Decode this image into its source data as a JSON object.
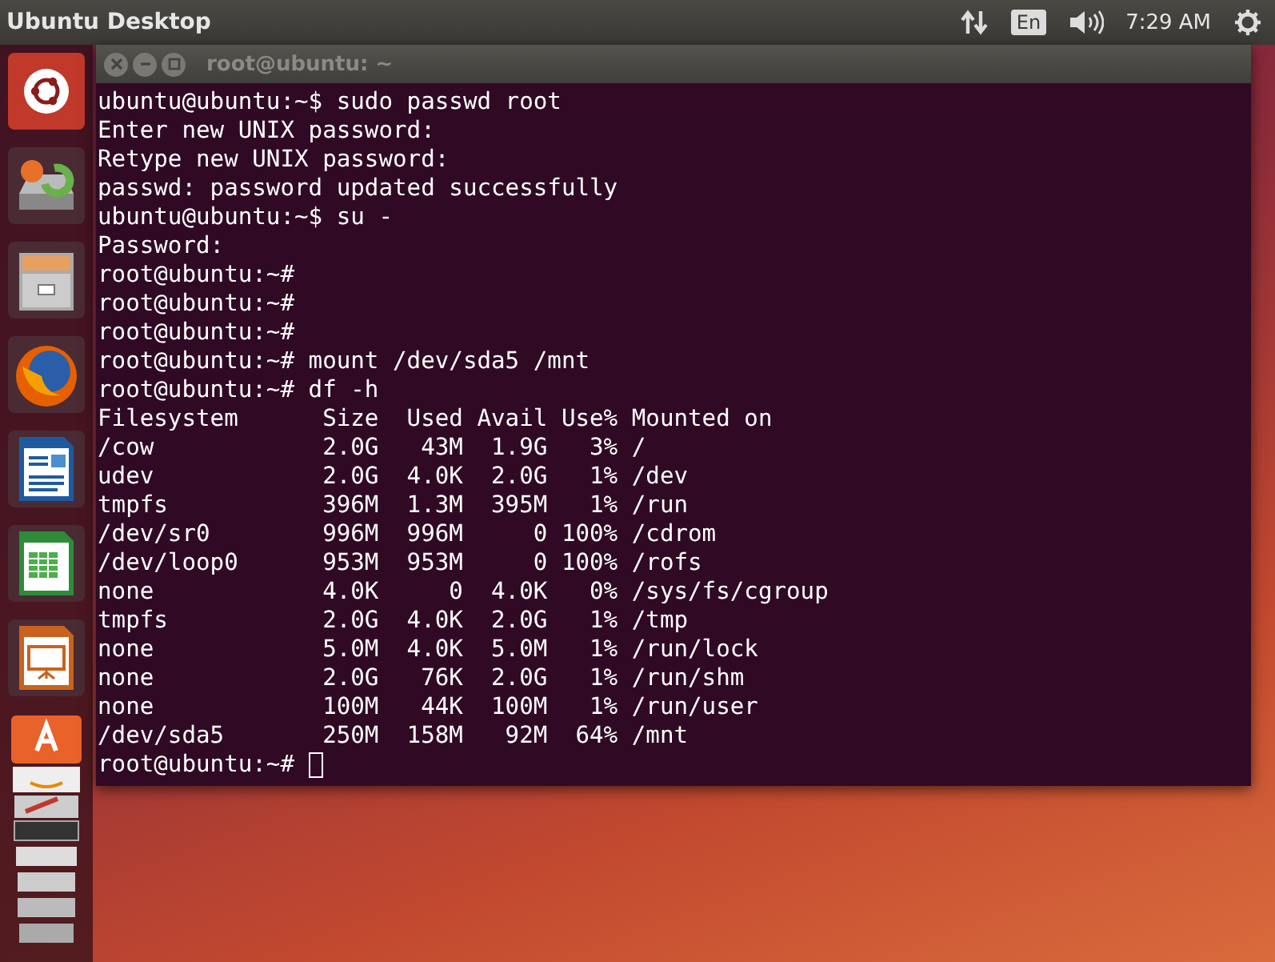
{
  "top_bar": {
    "title": "Ubuntu Desktop",
    "keyboard": "En",
    "clock": "7:29 AM"
  },
  "terminal": {
    "title": "root@ubuntu: ~",
    "lines": [
      "ubuntu@ubuntu:~$ sudo passwd root",
      "Enter new UNIX password:",
      "Retype new UNIX password:",
      "passwd: password updated successfully",
      "ubuntu@ubuntu:~$ su -",
      "Password:",
      "root@ubuntu:~#",
      "root@ubuntu:~#",
      "root@ubuntu:~#",
      "root@ubuntu:~# mount /dev/sda5 /mnt",
      "root@ubuntu:~# df -h",
      "Filesystem      Size  Used Avail Use% Mounted on",
      "/cow            2.0G   43M  1.9G   3% /",
      "udev            2.0G  4.0K  2.0G   1% /dev",
      "tmpfs           396M  1.3M  395M   1% /run",
      "/dev/sr0        996M  996M     0 100% /cdrom",
      "/dev/loop0      953M  953M     0 100% /rofs",
      "none            4.0K     0  4.0K   0% /sys/fs/cgroup",
      "tmpfs           2.0G  4.0K  2.0G   1% /tmp",
      "none            5.0M  4.0K  5.0M   1% /run/lock",
      "none            2.0G   76K  2.0G   1% /run/shm",
      "none            100M   44K  100M   1% /run/user",
      "/dev/sda5       250M  158M   92M  64% /mnt"
    ],
    "prompt": "root@ubuntu:~#"
  }
}
